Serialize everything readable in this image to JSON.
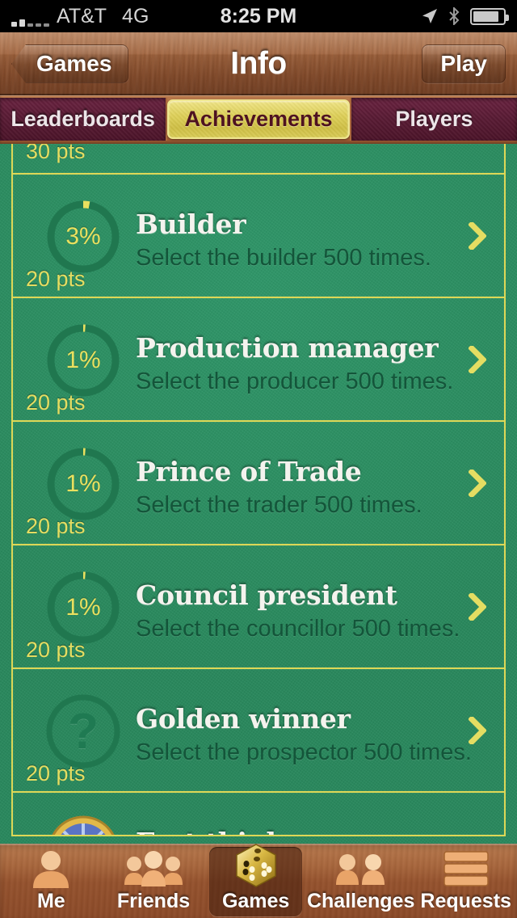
{
  "status_bar": {
    "carrier": "AT&T",
    "network": "4G",
    "time": "8:25 PM",
    "icons": [
      "signal-bars-icon",
      "location-arrow-icon",
      "bluetooth-icon",
      "battery-icon"
    ]
  },
  "nav_bar": {
    "back_label": "Games",
    "title": "Info",
    "action_label": "Play"
  },
  "segmented_control": {
    "options": [
      "Leaderboards",
      "Achievements",
      "Players"
    ],
    "selected": "Achievements"
  },
  "achievements": [
    {
      "title": "",
      "description": "",
      "progress_label": "",
      "points": "30 pts",
      "icon": "progress-ring-icon",
      "partial": "top"
    },
    {
      "title": "Builder",
      "description": "Select the builder 500 times.",
      "progress_label": "3%",
      "progress_percent": 3,
      "points": "20 pts",
      "icon": "progress-ring-icon"
    },
    {
      "title": "Production manager",
      "description": "Select the producer 500 times.",
      "progress_label": "1%",
      "progress_percent": 1,
      "points": "20 pts",
      "icon": "progress-ring-icon"
    },
    {
      "title": "Prince of Trade",
      "description": "Select the trader 500 times.",
      "progress_label": "1%",
      "progress_percent": 1,
      "points": "20 pts",
      "icon": "progress-ring-icon"
    },
    {
      "title": "Council president",
      "description": "Select the councillor 500 times.",
      "progress_label": "1%",
      "progress_percent": 1,
      "points": "20 pts",
      "icon": "progress-ring-icon"
    },
    {
      "title": "Golden winner",
      "description": "Select the prospector 500 times.",
      "progress_label": "?",
      "points": "20 pts",
      "icon": "question-mark-icon"
    },
    {
      "title": "Fast thinker",
      "description": "",
      "points": "",
      "icon": "medal-badge-icon",
      "partial": "bottom"
    }
  ],
  "tab_bar": {
    "items": [
      {
        "label": "Me",
        "icon": "person-icon",
        "selected": false
      },
      {
        "label": "Friends",
        "icon": "people-group-icon",
        "selected": false
      },
      {
        "label": "Games",
        "icon": "dice-icon",
        "selected": true
      },
      {
        "label": "Challenges",
        "icon": "two-people-icon",
        "selected": false
      },
      {
        "label": "Requests",
        "icon": "list-lines-icon",
        "selected": false
      }
    ]
  },
  "colors": {
    "felt_green": "#2b8d61",
    "row_border_yellow": "#ddd856",
    "points_yellow": "#e4dd62",
    "wood_brown": "#a8663c",
    "maroon": "#571a33",
    "gold_selected": "#ded059",
    "title_white": "#f4f3ee",
    "description_dark_green": "#14553a"
  }
}
